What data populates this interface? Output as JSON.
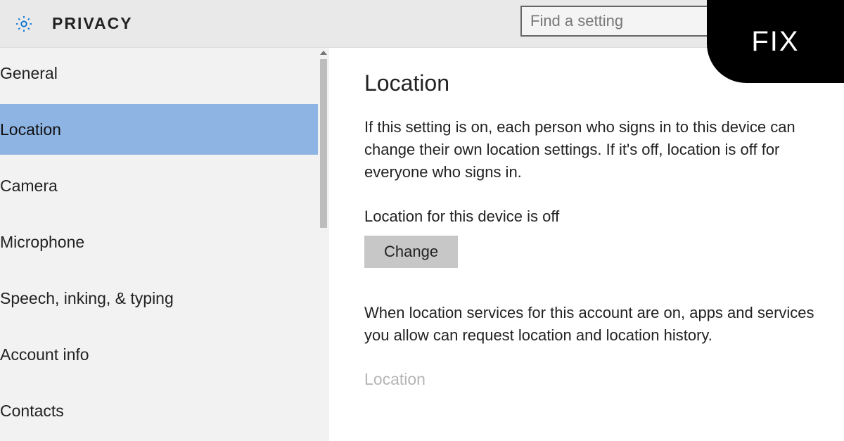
{
  "header": {
    "title": "PRIVACY",
    "search_placeholder": "Find a setting",
    "badge": "FIX"
  },
  "sidebar": {
    "items": [
      {
        "label": "General",
        "selected": false
      },
      {
        "label": "Location",
        "selected": true
      },
      {
        "label": "Camera",
        "selected": false
      },
      {
        "label": "Microphone",
        "selected": false
      },
      {
        "label": "Speech, inking, & typing",
        "selected": false
      },
      {
        "label": "Account info",
        "selected": false
      },
      {
        "label": "Contacts",
        "selected": false
      }
    ]
  },
  "main": {
    "heading": "Location",
    "description": "If this setting is on, each person who signs in to this device can change their own location settings. If it's off, location is off for everyone who signs in.",
    "status_text": "Location for this device is off",
    "change_button": "Change",
    "description2": "When location services for this account are on, apps and services you allow can request location and location history.",
    "disabled_label": "Location"
  }
}
